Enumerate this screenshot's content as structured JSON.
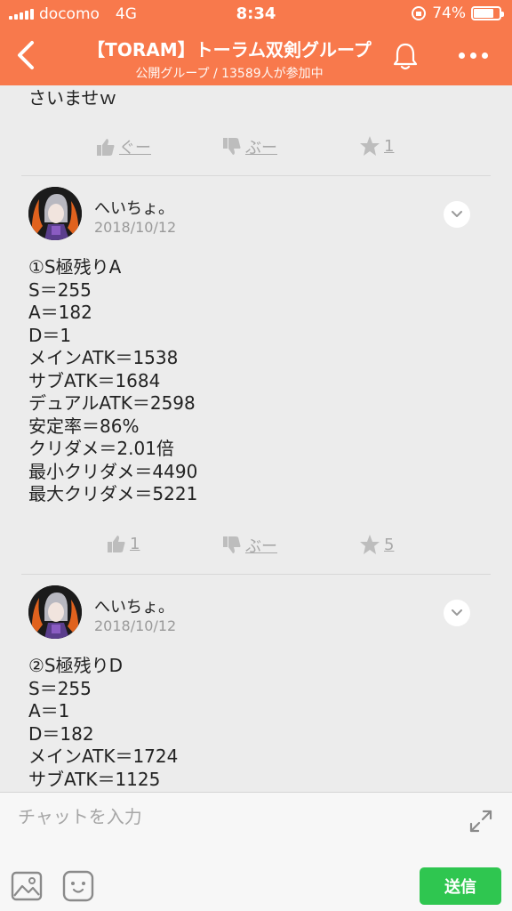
{
  "status_bar": {
    "carrier": "docomo",
    "network": "4G",
    "time": "8:34",
    "battery": "74%",
    "battery_level": 0.74
  },
  "header": {
    "title": "【TORAM】トーラム双剣グループ",
    "subtitle": "公開グループ / 13589人が参加中"
  },
  "feed": {
    "partial_post": {
      "tail_text": "さいませｗ",
      "reactions": {
        "good": "ぐー",
        "bad": "ぶー",
        "star": "1"
      }
    },
    "posts": [
      {
        "author": "へいちょ。",
        "date": "2018/10/12",
        "lines": [
          "①S極残りA",
          "S＝255",
          "A＝182",
          "D＝1",
          "メインATK＝1538",
          "サブATK＝1684",
          "デュアルATK＝2598",
          "安定率＝86%",
          "クリダメ＝2.01倍",
          "最小クリダメ＝4490",
          "最大クリダメ＝5221"
        ],
        "reactions": {
          "good": "1",
          "bad": "ぶー",
          "star": "5"
        }
      },
      {
        "author": "へいちょ。",
        "date": "2018/10/12",
        "lines": [
          "②S極残りD",
          "S＝255",
          "A＝1",
          "D＝182",
          "メインATK＝1724",
          "サブATK＝1125"
        ]
      }
    ]
  },
  "composer": {
    "placeholder": "チャットを入力",
    "send_label": "送信"
  },
  "colors": {
    "accent": "#f8794c",
    "send": "#2fc650",
    "muted": "#a8a8a8"
  }
}
